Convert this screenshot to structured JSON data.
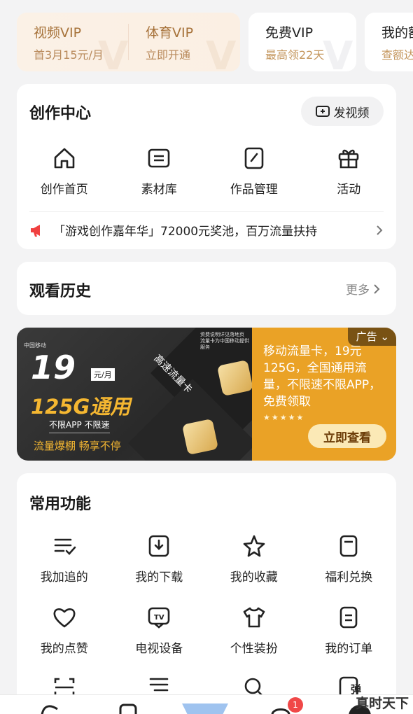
{
  "vip": {
    "video": {
      "title": "视频VIP",
      "sub": "首3月15元/月"
    },
    "sports": {
      "title": "体育VIP",
      "sub": "立即开通"
    },
    "free": {
      "title": "免费VIP",
      "sub": "最高领22天"
    },
    "mine": {
      "title": "我的额",
      "sub": "查额达"
    }
  },
  "creation": {
    "title": "创作中心",
    "upload_label": "发视频",
    "items": [
      {
        "label": "创作首页",
        "icon": "home-icon"
      },
      {
        "label": "素材库",
        "icon": "folder-icon"
      },
      {
        "label": "作品管理",
        "icon": "edit-doc-icon"
      },
      {
        "label": "活动",
        "icon": "gift-icon"
      }
    ],
    "promo": "「游戏创作嘉年华」72000元奖池，百万流量扶持"
  },
  "history": {
    "title": "观看历史",
    "more": "更多"
  },
  "ad": {
    "tag": "广告",
    "text": "移动流量卡，19元125G，全国通用流量，不限速不限APP，免费领取",
    "stars": "★★★★★",
    "button": "立即查看",
    "banner": {
      "price": "19",
      "unit": "元/月",
      "big": "125G通用",
      "small": "不限APP 不限速",
      "slogan": "流量爆棚 畅享不停",
      "diag": "高速流量卡",
      "fine1": "资费说明详见落地页",
      "fine2": "流量卡为中国移动提供服务",
      "logo": "中国移动"
    },
    "colors": {
      "left_bg": "#2e2e2e",
      "right_bg": "#eaa226",
      "accent": "#f5b731"
    }
  },
  "common": {
    "title": "常用功能",
    "rows": [
      [
        {
          "label": "我加追的",
          "icon": "list-check-icon"
        },
        {
          "label": "我的下载",
          "icon": "download-icon"
        },
        {
          "label": "我的收藏",
          "icon": "star-icon"
        },
        {
          "label": "福利兑换",
          "icon": "coupon-icon"
        }
      ],
      [
        {
          "label": "我的点赞",
          "icon": "heart-icon"
        },
        {
          "label": "电视设备",
          "icon": "tv-icon"
        },
        {
          "label": "个性装扮",
          "icon": "shirt-icon"
        },
        {
          "label": "我的订单",
          "icon": "order-icon"
        }
      ]
    ],
    "partial_icon_text": "弹"
  },
  "bottom": {
    "badge": "1"
  },
  "watermark": "真时天下"
}
